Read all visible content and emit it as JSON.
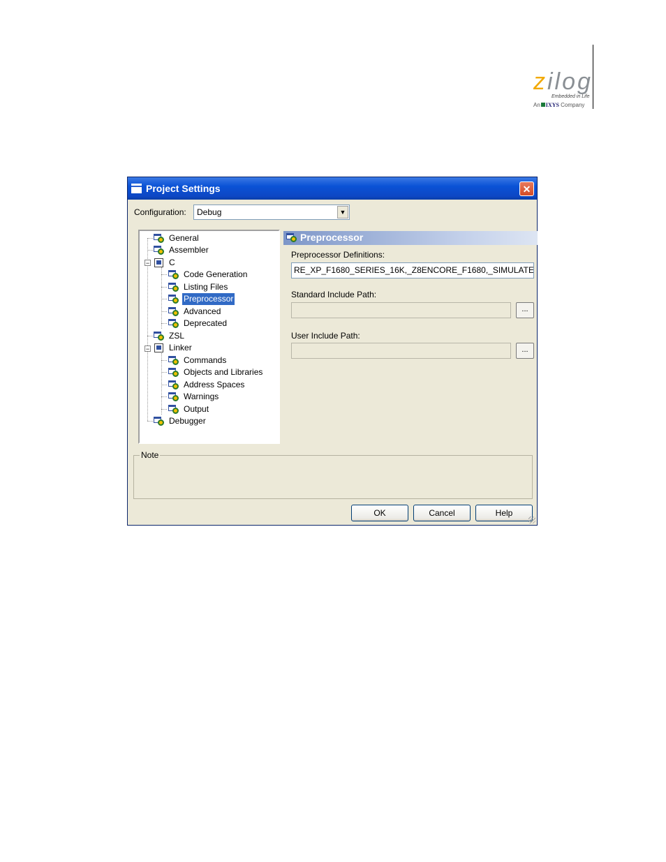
{
  "logo": {
    "word_first": "z",
    "word_rest": "ilog",
    "tagline": "Embedded in Life",
    "company_prefix": "An",
    "company_name": "IXYS",
    "company_suffix": "Company",
    "colors": {
      "accent": "#f2a900",
      "gray": "#8a8f94"
    }
  },
  "dialog": {
    "title": "Project Settings",
    "close_label": "✕",
    "configuration": {
      "label": "Configuration:",
      "value": "Debug"
    },
    "tree": {
      "items": [
        {
          "label": "General"
        },
        {
          "label": "Assembler"
        },
        {
          "label": "C"
        },
        {
          "label": "Code Generation"
        },
        {
          "label": "Listing Files"
        },
        {
          "label": "Preprocessor"
        },
        {
          "label": "Advanced"
        },
        {
          "label": "Deprecated"
        },
        {
          "label": "ZSL"
        },
        {
          "label": "Linker"
        },
        {
          "label": "Commands"
        },
        {
          "label": "Objects and Libraries"
        },
        {
          "label": "Address Spaces"
        },
        {
          "label": "Warnings"
        },
        {
          "label": "Output"
        },
        {
          "label": "Debugger"
        }
      ],
      "selected": "Preprocessor"
    },
    "panel": {
      "title": "Preprocessor",
      "preprocessor_definitions": {
        "label": "Preprocessor Definitions:",
        "value": "RE_XP_F1680_SERIES_16K,_Z8ENCORE_F1680,_SIMULATE"
      },
      "standard_include_path": {
        "label": "Standard Include Path:",
        "value": "",
        "browse_label": "..."
      },
      "user_include_path": {
        "label": "User Include Path:",
        "value": "",
        "browse_label": "..."
      }
    },
    "note": {
      "label": "Note"
    },
    "buttons": {
      "ok": "OK",
      "cancel": "Cancel",
      "help": "Help"
    }
  }
}
